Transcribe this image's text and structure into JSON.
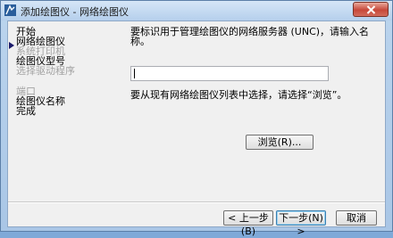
{
  "window": {
    "title": "添加绘图仪 - 网络绘图仪",
    "app_icon": "plotter-app-icon"
  },
  "steps": [
    {
      "label": "开始",
      "state": "done"
    },
    {
      "label": "网络绘图仪",
      "state": "current"
    },
    {
      "label": "系统打印机",
      "state": "disabled"
    },
    {
      "label": "绘图仪型号",
      "state": "done"
    },
    {
      "label": "选择驱动程序",
      "state": "disabled"
    },
    {
      "label": "端口",
      "state": "disabled"
    },
    {
      "label": "绘图仪名称",
      "state": "done"
    },
    {
      "label": "完成",
      "state": "done"
    }
  ],
  "main": {
    "instruction_line1": "要标识用于管理绘图仪的网络服务器 (UNC)，请输入名",
    "instruction_line2": "称。",
    "unc_value": "",
    "browse_hint": "要从现有网络绘图仪列表中选择，请选择“浏览”。",
    "browse_label": "浏览(R)..."
  },
  "footer": {
    "back_label": "< 上一步(B)",
    "next_label": "下一步(N) >",
    "cancel_label": "取消"
  }
}
